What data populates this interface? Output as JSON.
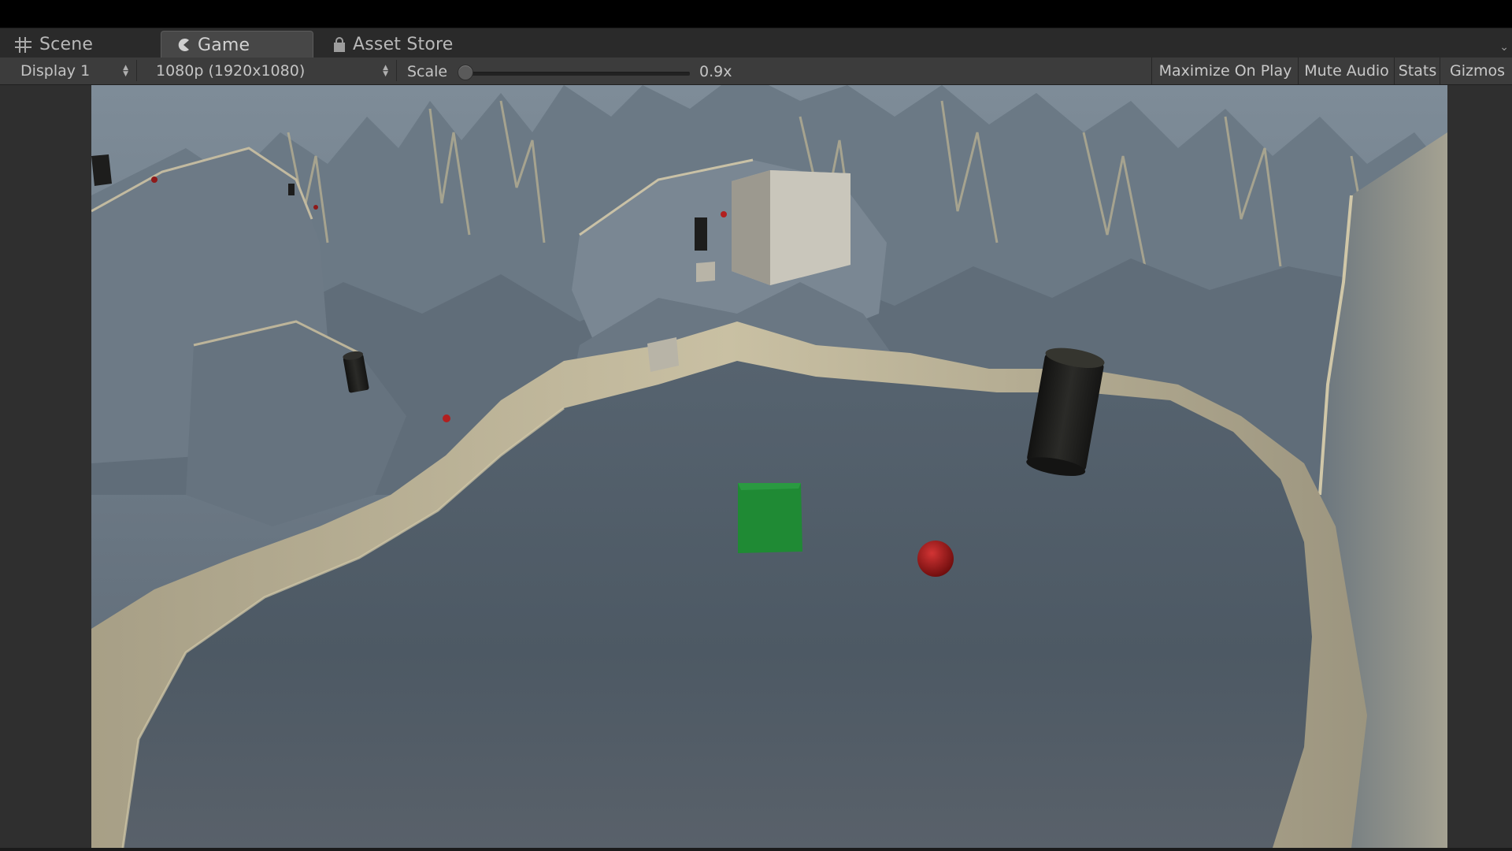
{
  "tabs": {
    "scene": "Scene",
    "game": "Game",
    "asset_store": "Asset Store"
  },
  "toolbar": {
    "display": "Display 1",
    "resolution": "1080p (1920x1080)",
    "scale_label": "Scale",
    "scale_value": "0.9x",
    "scale_fraction": 0.02,
    "maximize_on_play": "Maximize On Play",
    "mute_audio": "Mute Audio",
    "stats": "Stats",
    "gizmos": "Gizmos"
  },
  "icons": {
    "scene": "grid-icon",
    "game": "pacman-icon",
    "asset_store": "shopping-bag-icon",
    "dropdown": "up-down-arrows-icon"
  },
  "colors": {
    "terrain": "#5a6a78",
    "terrain_highlight": "#c8bfa4",
    "green_cube": "#1f8a34",
    "red_sphere": "#9b1212",
    "black_cylinder": "#1e1e1c",
    "white_cube": "#b6b3a8"
  }
}
